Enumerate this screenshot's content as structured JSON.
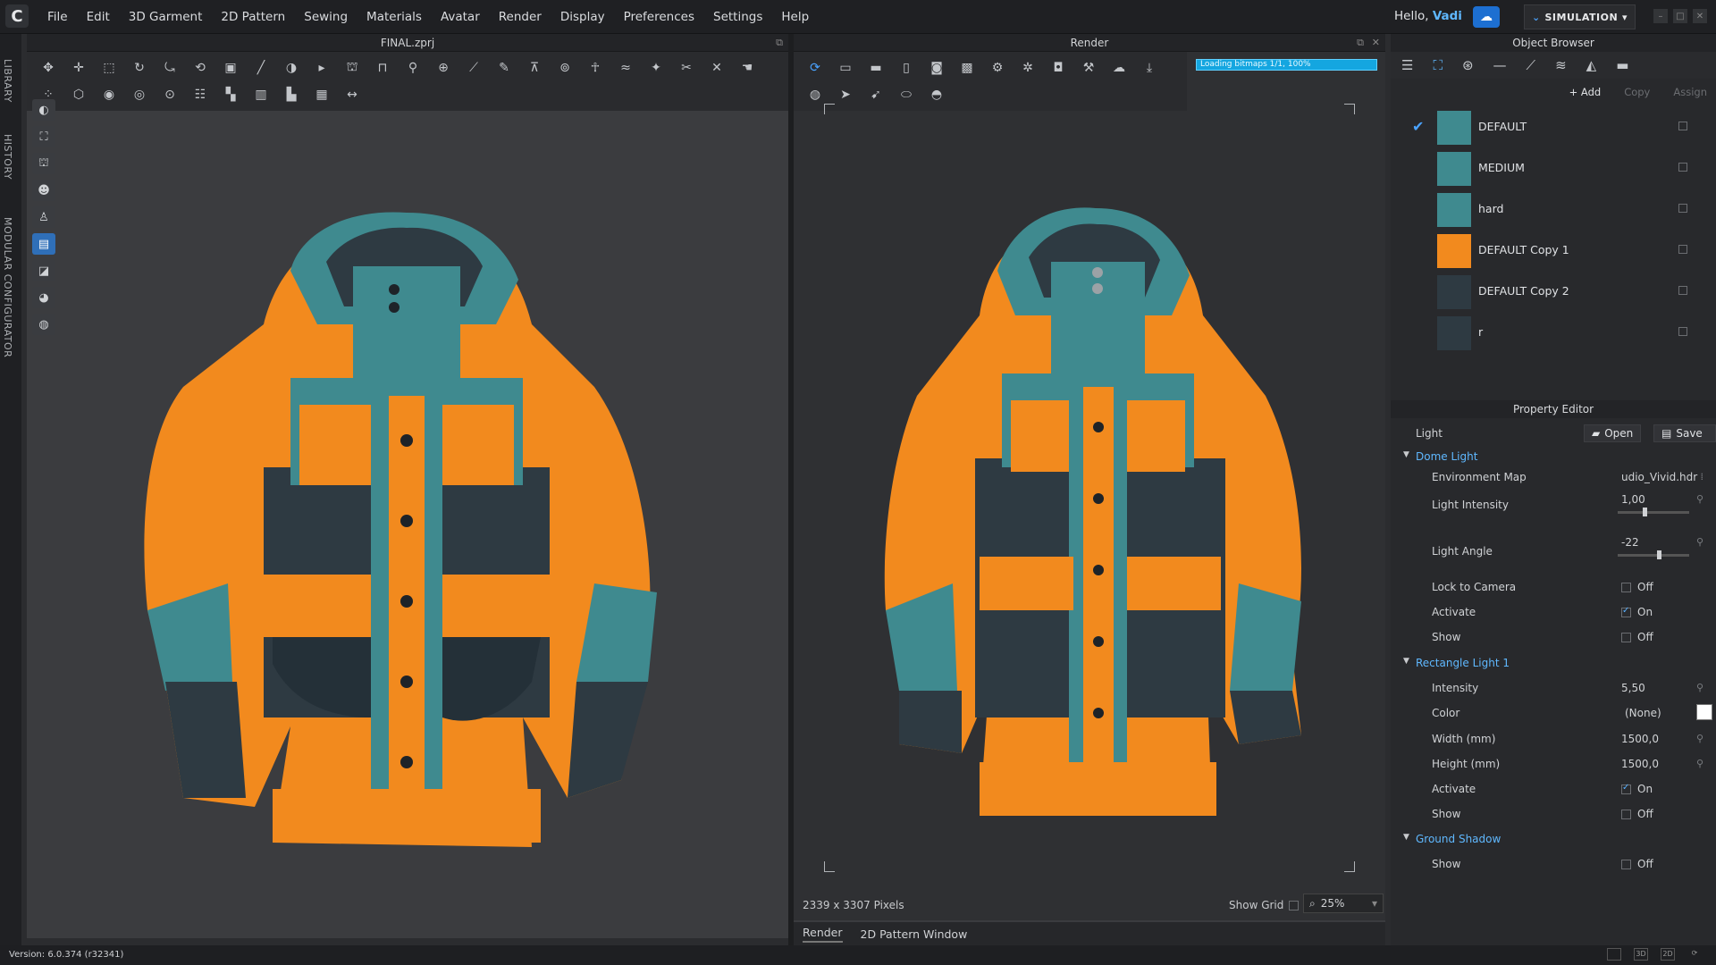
{
  "app": {
    "logo": "C",
    "hello_prefix": "Hello,",
    "user": "Vadi",
    "mode": "SIMULATION"
  },
  "menu": [
    "File",
    "Edit",
    "3D Garment",
    "2D Pattern",
    "Sewing",
    "Materials",
    "Avatar",
    "Render",
    "Display",
    "Preferences",
    "Settings",
    "Help"
  ],
  "left_tabs": [
    "LIBRARY",
    "HISTORY",
    "MODULAR CONFIGURATOR"
  ],
  "viewport3d": {
    "title": "FINAL.zprj"
  },
  "render": {
    "title": "Render",
    "progress_text": "Loading bitmaps 1/1, 100%",
    "progress": 1.0,
    "resolution": "2339 x 3307 Pixels",
    "show_grid_label": "Show Grid",
    "zoom": "25%",
    "tabs": [
      "Render",
      "2D Pattern Window"
    ]
  },
  "object_browser": {
    "title": "Object Browser",
    "buttons": {
      "add": "+ Add",
      "copy": "Copy",
      "assign": "Assign"
    },
    "materials": [
      {
        "name": "DEFAULT",
        "color": "#3f8a8f",
        "checked": true
      },
      {
        "name": "MEDIUM",
        "color": "#3f8a8f",
        "checked": false
      },
      {
        "name": "hard",
        "color": "#3f8a8f",
        "checked": false
      },
      {
        "name": "DEFAULT Copy 1",
        "color": "#f28a1e",
        "checked": false
      },
      {
        "name": "DEFAULT Copy 2",
        "color": "#2e3a42",
        "checked": false
      },
      {
        "name": "r",
        "color": "#2e3a42",
        "checked": false
      }
    ]
  },
  "property_editor": {
    "title": "Property Editor",
    "light_label": "Light",
    "open": "Open",
    "save": "Save",
    "dome": {
      "title": "Dome Light",
      "env_label": "Environment Map",
      "env_value": "udio_Vivid.hdr",
      "intensity_label": "Light Intensity",
      "intensity": "1,00",
      "angle_label": "Light Angle",
      "angle": "-22",
      "lock_label": "Lock to Camera",
      "lock": "Off",
      "activate_label": "Activate",
      "activate": "On",
      "show_label": "Show",
      "show": "Off"
    },
    "rect": {
      "title": "Rectangle Light 1",
      "intensity_label": "Intensity",
      "intensity": "5,50",
      "color_label": "Color",
      "color_value": "(None)",
      "width_label": "Width (mm)",
      "width": "1500,0",
      "height_label": "Height (mm)",
      "height": "1500,0",
      "activate_label": "Activate",
      "activate": "On",
      "show_label": "Show",
      "show": "Off"
    },
    "shadow": {
      "title": "Ground Shadow",
      "show_label": "Show",
      "show": "Off"
    }
  },
  "status": {
    "version": "Version: 6.0.374 (r32341)"
  },
  "colors": {
    "orange": "#f28a1e",
    "teal": "#3f8a8f",
    "navy": "#2e3a42",
    "accent": "#4aa3ff"
  }
}
